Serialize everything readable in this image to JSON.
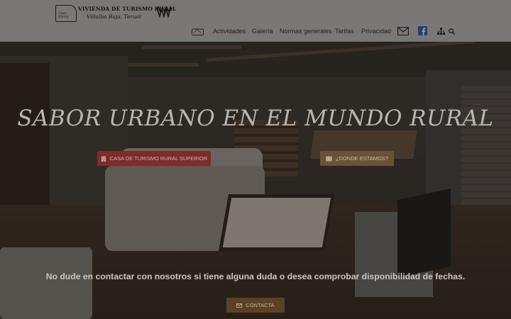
{
  "header": {
    "logo": {
      "house_text": "Casa Elenni",
      "title": "VIVIENDA DE TURISMO RURAL",
      "subtitle": "Villalba Baja, Teruel"
    },
    "nav": [
      {
        "label": "Actividades"
      },
      {
        "label": "Galería"
      },
      {
        "label": "Normas generales"
      },
      {
        "label": "Tarifas"
      },
      {
        "label": "Privacidad"
      }
    ],
    "icons": [
      "home-logo-icon",
      "mail-icon",
      "facebook-icon",
      "sitemap-icon",
      "search-icon"
    ]
  },
  "hero": {
    "title": "SABOR URBANO EN EL MUNDO RURAL",
    "buttons": [
      {
        "label": "CASA DE TURISMO RURAL SUPERIOR",
        "icon": "building-icon"
      },
      {
        "label": "¿DONDE ESTAMOS?",
        "icon": "map-icon"
      }
    ],
    "message": "No dude en contactar con nosotros si tiene alguna duda o desea comprobar disponibilidad de fechas.",
    "contact_button": {
      "label": "CONTACTA",
      "icon": "envelope-icon"
    }
  },
  "colors": {
    "header_bg": "#7a7877",
    "button_red": "#7d2d28",
    "button_brown": "#6a5236",
    "contact_bg": "#5c4126"
  }
}
